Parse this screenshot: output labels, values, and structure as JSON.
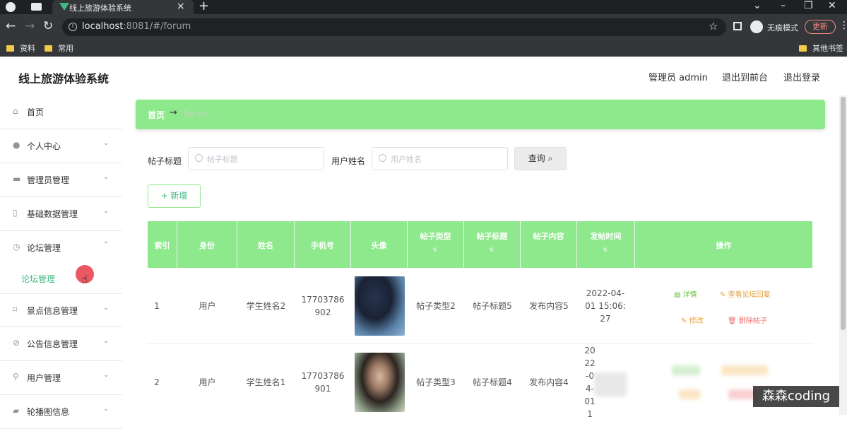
{
  "browser": {
    "tab_title": "线上旅游体验系统",
    "url_host": "localhost",
    "url_rest": ":8081/#/forum",
    "incognito_label": "无痕模式",
    "update_label": "更新",
    "bookmarks": [
      "资料",
      "常用"
    ],
    "other_bookmarks": "其他书签"
  },
  "header": {
    "title": "线上旅游体验系统",
    "admin_label": "管理员 admin",
    "front_link": "退出到前台",
    "logout_link": "退出登录"
  },
  "sidebar": {
    "items": [
      {
        "label": "首页",
        "icon": "home-icon"
      },
      {
        "label": "个人中心",
        "icon": "user-icon"
      },
      {
        "label": "管理员管理",
        "icon": "admin-icon"
      },
      {
        "label": "基础数据管理",
        "icon": "data-icon"
      },
      {
        "label": "论坛管理",
        "icon": "forum-icon"
      },
      {
        "label": "景点信息管理",
        "icon": "scenic-icon"
      },
      {
        "label": "公告信息管理",
        "icon": "notice-icon"
      },
      {
        "label": "用户管理",
        "icon": "users-icon"
      },
      {
        "label": "轮播图信息",
        "icon": "carousel-icon"
      }
    ],
    "submenu_label": "论坛管理"
  },
  "breadcrumb": {
    "home": "首页",
    "arrow": "→",
    "current": "forum"
  },
  "filters": {
    "title_label": "帖子标题",
    "title_placeholder": "帖子标题",
    "user_label": "用户姓名",
    "user_placeholder": "用户姓名",
    "query_label": "查询"
  },
  "add_label": "+ 新增",
  "table": {
    "columns": [
      "索引",
      "身份",
      "姓名",
      "手机号",
      "头像",
      "帖子类型",
      "帖子标题",
      "帖子内容",
      "发帖时间",
      "操作"
    ],
    "rows": [
      {
        "index": "1",
        "identity": "用户",
        "name": "学生姓名2",
        "phone": "17703786902",
        "type": "帖子类型2",
        "title": "帖子标题5",
        "content": "发布内容5",
        "time": "2022-04-01 15:06:27",
        "actions": {
          "detail": "详情",
          "view": "查看论坛回复",
          "edit": "修改",
          "delete": "删除帖子"
        }
      },
      {
        "index": "2",
        "identity": "用户",
        "name": "学生姓名1",
        "phone": "17703786901",
        "type": "帖子类型3",
        "title": "帖子标题4",
        "content": "发布内容4",
        "time": "2022-04-01 1",
        "actions": {}
      }
    ]
  },
  "watermark": "森森coding",
  "colors": {
    "accent": "#8ee98c",
    "active_text": "#41b883"
  }
}
